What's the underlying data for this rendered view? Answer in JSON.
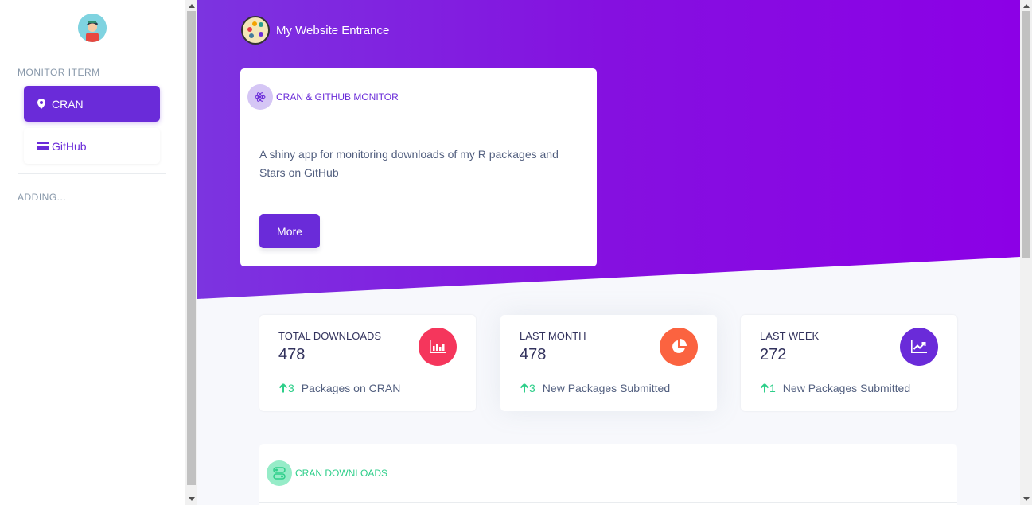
{
  "sidebar": {
    "section_title": "MONITOR ITERM",
    "items": [
      {
        "label": "CRAN",
        "icon": "map-pin-icon",
        "active": true
      },
      {
        "label": "GitHub",
        "icon": "credit-card-icon",
        "active": false
      }
    ],
    "adding_label": "ADDING..."
  },
  "brand": {
    "title": "My Website Entrance",
    "icon": "palette-icon"
  },
  "intro": {
    "header": "CRAN & GITHUB MONITOR",
    "icon": "atom-icon",
    "text": "A shiny app for monitoring downloads of my R packages and Stars on GitHub",
    "button": "More"
  },
  "stats": [
    {
      "title": "TOTAL DOWNLOADS",
      "value": "478",
      "delta": "3",
      "desc": "Packages on CRAN",
      "icon": "bar-chart-icon",
      "color": "#f5365c"
    },
    {
      "title": "LAST MONTH",
      "value": "478",
      "delta": "3",
      "desc": "New Packages Submitted",
      "icon": "pie-chart-icon",
      "color": "#fb6340"
    },
    {
      "title": "LAST WEEK",
      "value": "272",
      "delta": "1",
      "desc": "New Packages Submitted",
      "icon": "line-chart-icon",
      "color": "#6a2bd9"
    }
  ],
  "downloads": {
    "header": "CRAN DOWNLOADS",
    "icon": "toggle-icon"
  },
  "colors": {
    "accent": "#6a2bd9",
    "success": "#2dce89"
  }
}
